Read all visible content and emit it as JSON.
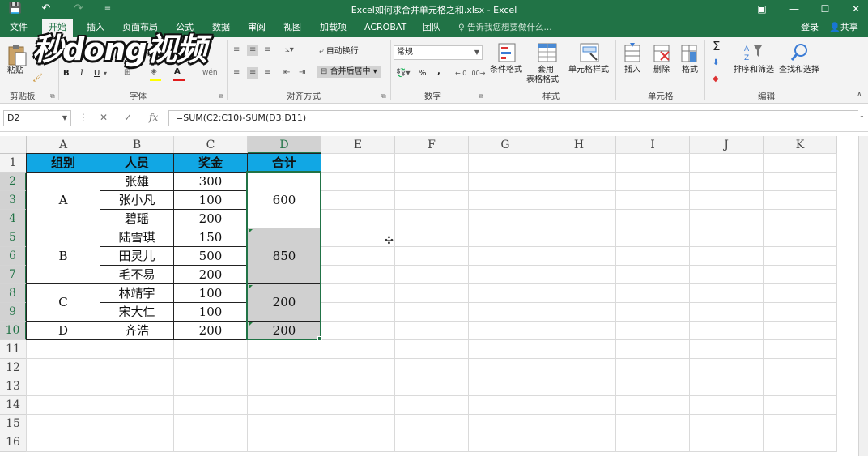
{
  "title": "Excel如何求合并单元格之和.xlsx - Excel",
  "window_controls": {
    "minimize": "—",
    "restore": "☐",
    "close": "✕",
    "ribbon_display": "▣"
  },
  "quick_access": {
    "save": "💾",
    "undo": "↶",
    "redo": "↷",
    "customize": "="
  },
  "tabs": [
    "文件",
    "开始",
    "插入",
    "页面布局",
    "公式",
    "数据",
    "审阅",
    "视图",
    "加载项",
    "ACROBAT",
    "团队"
  ],
  "active_tab": "开始",
  "tell_me": "告诉我您想要做什么...",
  "login": "登录",
  "share": "共享",
  "watermark": "秒dong视频",
  "ribbon": {
    "clipboard": {
      "paste": "粘贴",
      "label": "剪贴板"
    },
    "font": {
      "label": "字体",
      "bold": "B",
      "italic": "I",
      "underline": "U"
    },
    "alignment": {
      "label": "对齐方式",
      "wrap": "自动换行",
      "merge": "合并后居中"
    },
    "number": {
      "label": "数字",
      "format": "常规",
      "percent": "%",
      "comma": ","
    },
    "styles": {
      "label": "样式",
      "conditional": "条件格式",
      "table": "套用",
      "table2": "表格格式",
      "cell": "单元格样式"
    },
    "cells": {
      "label": "单元格",
      "insert": "插入",
      "delete": "删除",
      "format": "格式"
    },
    "editing": {
      "label": "编辑",
      "sort": "排序和筛选",
      "find": "查找和选择",
      "sigma": "Σ"
    }
  },
  "name_box": "D2",
  "formula": "=SUM(C2:C10)-SUM(D3:D11)",
  "fx": "fx",
  "columns": [
    "A",
    "B",
    "C",
    "D",
    "E",
    "F",
    "G",
    "H",
    "I",
    "J",
    "K"
  ],
  "rows": [
    "1",
    "2",
    "3",
    "4",
    "5",
    "6",
    "7",
    "8",
    "9",
    "10",
    "11",
    "12",
    "13",
    "14",
    "15",
    "16"
  ],
  "table": {
    "headers": [
      "组别",
      "人员",
      "奖金",
      "合计"
    ],
    "groups": [
      "A",
      "B",
      "C",
      "D"
    ],
    "people": [
      "张雄",
      "张小凡",
      "碧瑶",
      "陆雪琪",
      "田灵儿",
      "毛不易",
      "林靖宇",
      "宋大仁",
      "齐浩"
    ],
    "bonus": [
      "300",
      "100",
      "200",
      "150",
      "500",
      "200",
      "100",
      "100",
      "200"
    ],
    "totals": [
      "600",
      "850",
      "200",
      "200"
    ]
  },
  "colors": {
    "excel_green": "#217346",
    "header_fill": "#11a7e4",
    "merged_gray": "#d0d0d0"
  }
}
